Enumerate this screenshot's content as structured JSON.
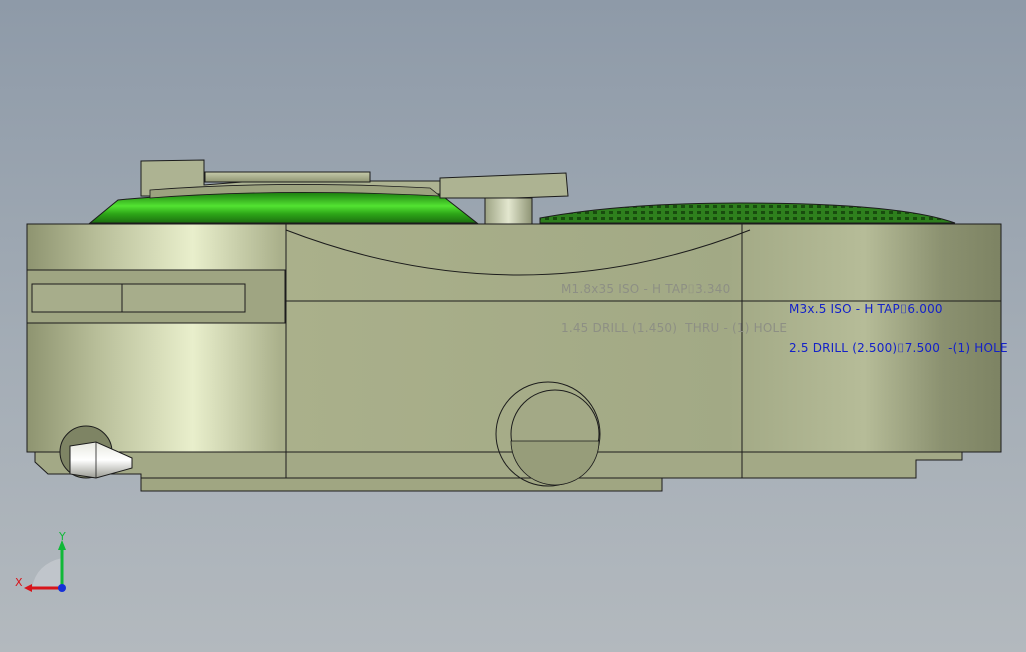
{
  "viewport": {
    "view_name": "cad-3d-viewport",
    "background_top": "#8e9aa8",
    "background_bottom": "#b3b9be"
  },
  "model": {
    "body_color": "#a2a985",
    "accent_color": "#3fcc22",
    "edge_color": "#1c1c1c"
  },
  "annotations": [
    {
      "id": "hole-callout-1",
      "line1": "M1.8x35 ISO - H TAP⌷3.340",
      "line2": "1.45 DRILL (1.450)  THRU - (1) HOLE",
      "color": "#8d8f84"
    },
    {
      "id": "hole-callout-2",
      "line1": "M3x.5 ISO - H TAP⌷6.000",
      "line2": "2.5 DRILL (2.500)⌷7.500  -(1) HOLE",
      "color": "#1421c8"
    }
  ],
  "triad": {
    "x_label": "X",
    "y_label": "Y",
    "x_color": "#d8141a",
    "y_color": "#10b838",
    "z_color": "#1630d8"
  }
}
